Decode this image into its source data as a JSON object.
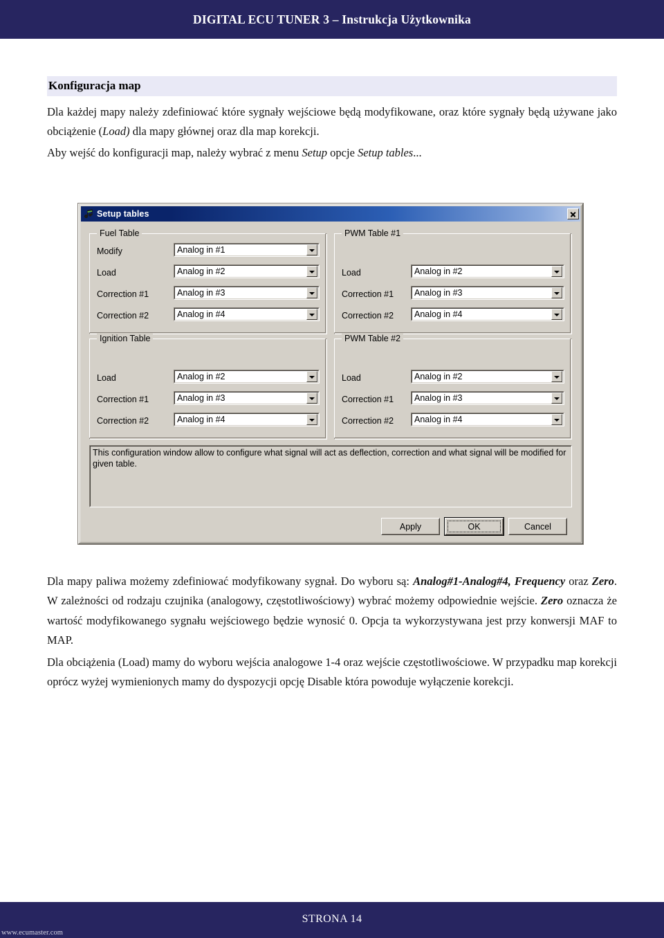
{
  "document": {
    "header_title": "DIGITAL ECU TUNER 3 – Instrukcja Użytkownika",
    "footer_page": "STRONA 14",
    "footer_site": "www.ecumaster.com",
    "accent_navy": "#272560",
    "heading_band": "#e9e9f6"
  },
  "section": {
    "heading": "Konfiguracja map",
    "para1_a": "Dla każdej mapy należy zdefiniować które sygnały wejściowe będą modyfikowane, oraz które sygnały będą używane jako obciążenie (",
    "para1_load": "Load)",
    "para1_b": " dla mapy głównej oraz dla map korekcji.",
    "para2_a": "Aby wejść do konfiguracji map, należy wybrać z menu ",
    "para2_setup": "Setup",
    "para2_b": " opcje ",
    "para2_setup_tables": "Setup tables",
    "para2_c": "...",
    "para3_a": "Dla mapy paliwa możemy zdefiniować modyfikowany sygnał. Do wyboru są: ",
    "para3_opts": "Analog#1-Analog#4, Frequency",
    "para3_b": " oraz ",
    "para3_zero": "Zero",
    "para3_c": ". W zależności od rodzaju czujnika (analogowy, częstotliwościowy) wybrać możemy odpowiednie wejście. ",
    "para3_zero2": "Zero",
    "para3_d": " oznacza że wartość modyfikowanego sygnału wejściowego będzie wynosić 0. Opcja ta wykorzystywana jest przy konwersji MAF to MAP.",
    "para4": "Dla obciążenia (Load)  mamy do wyboru wejścia analogowe 1-4 oraz wejście częstotliwościowe. W przypadku map korekcji oprócz wyżej wymienionych mamy do dyspozycji opcję Disable która powoduje  wyłączenie korekcji."
  },
  "dialog": {
    "title": "Setup tables",
    "icon": "app-icon",
    "close_icon": "close-icon",
    "groups": [
      {
        "id": "fuel",
        "legend": "Fuel Table",
        "rows": [
          {
            "label": "Modify",
            "value": "Analog in #1"
          },
          {
            "label": "Load",
            "value": "Analog in #2"
          },
          {
            "label": "Correction #1",
            "value": "Analog in #3"
          },
          {
            "label": "Correction #2",
            "value": "Analog in #4"
          }
        ]
      },
      {
        "id": "pwm1",
        "legend": "PWM Table #1",
        "rows": [
          {
            "label": "Load",
            "value": "Analog in #2"
          },
          {
            "label": "Correction #1",
            "value": "Analog in #3"
          },
          {
            "label": "Correction #2",
            "value": "Analog in #4"
          }
        ]
      },
      {
        "id": "ignition",
        "legend": "Ignition Table",
        "rows": [
          {
            "label": "Load",
            "value": "Analog in #2"
          },
          {
            "label": "Correction #1",
            "value": "Analog in #3"
          },
          {
            "label": "Correction #2",
            "value": "Analog in #4"
          }
        ]
      },
      {
        "id": "pwm2",
        "legend": "PWM Table #2",
        "rows": [
          {
            "label": "Load",
            "value": "Analog in #2"
          },
          {
            "label": "Correction #1",
            "value": "Analog in #3"
          },
          {
            "label": "Correction #2",
            "value": "Analog in #4"
          }
        ]
      }
    ],
    "description": "This configuration window allow to configure what signal will act as deflection, correction and what signal will be modified for given table.",
    "buttons": {
      "apply": "Apply",
      "ok": "OK",
      "cancel": "Cancel"
    }
  }
}
